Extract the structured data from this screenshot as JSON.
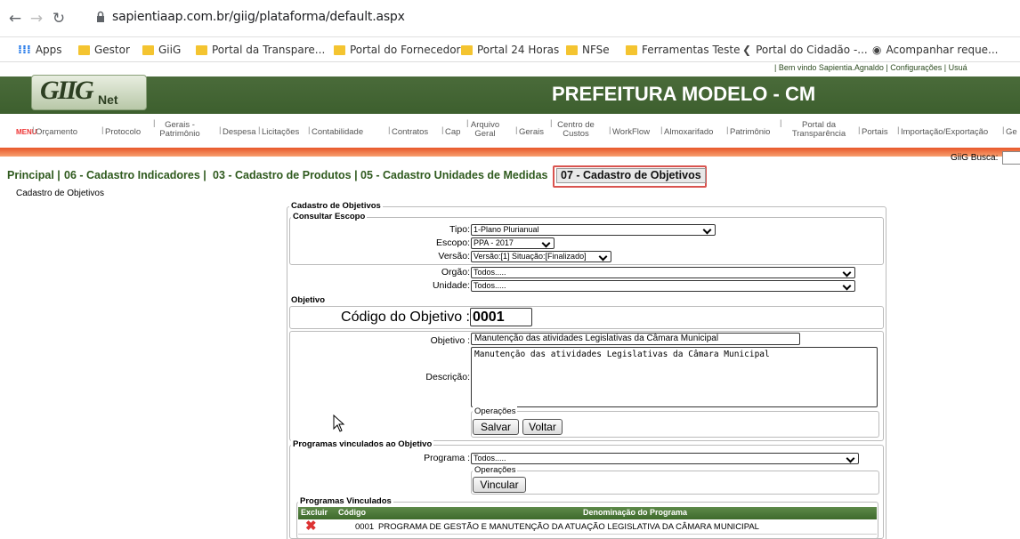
{
  "browser": {
    "url": "sapientiaap.com.br/giig/plataforma/default.aspx",
    "bookmarks": [
      "Apps",
      "Gestor",
      "GiiG",
      "Portal da Transpare...",
      "Portal do Fornecedor",
      "Portal 24 Horas",
      "NFSe",
      "Ferramentas Teste",
      "Portal do Cidadão -...",
      "Acompanhar reque..."
    ]
  },
  "header": {
    "welcome": "| Bem vindo Sapientia.Agnaldo   |  Configurações   |  Usuá",
    "logo_text": "GIIG",
    "logo_sub": "Net",
    "title": "PREFEITURA MODELO - CM"
  },
  "menu": {
    "label": "MENU",
    "items": [
      "Orçamento",
      "Protocolo",
      "Gerais - Patrimônio",
      "Despesa",
      "Licitações",
      "Contabilidade",
      "Contratos",
      "Cap",
      "Arquivo Geral",
      "Gerais",
      "Centro de Custos",
      "WorkFlow",
      "Almoxarifado",
      "Patrimônio",
      "Portal da Transparência",
      "Portais",
      "Importação/Exportação",
      "Ge"
    ],
    "busca_label": "GiiG Busca:"
  },
  "tabs": [
    "Principal",
    "06 - Cadastro Indicadores",
    "03 - Cadastro de Produtos",
    "05 - Cadastro Unidades de Medidas",
    "07 - Cadastro de Objetivos"
  ],
  "breadcrumb": "Cadastro de Objetivos",
  "form": {
    "legend_main": "Cadastro de Objetivos",
    "escopo": {
      "legend": "Consultar Escopo",
      "tipo_label": "Tipo:",
      "tipo_value": "1-Plano Plurianual",
      "escopo_label": "Escopo:",
      "escopo_value": "PPA - 2017",
      "versao_label": "Versão:",
      "versao_value": "Versão:[1] Situação:[Finalizado]",
      "orgao_label": "Orgão:",
      "orgao_value": "Todos.....",
      "unidade_label": "Unidade:",
      "unidade_value": "Todos....."
    },
    "objetivo": {
      "legend": "Objetivo",
      "codigo_label": "Código do Objetivo :",
      "codigo_value": "0001",
      "objetivo_label": "Objetivo :",
      "objetivo_value": "Manutenção das atividades Legislativas da Câmara Municipal",
      "descricao_label": "Descrição:",
      "descricao_value": "Manutenção das atividades Legislativas da Câmara Municipal",
      "operacoes_legend": "Operações",
      "salvar": "Salvar",
      "voltar": "Voltar"
    },
    "programas": {
      "legend": "Programas vinculados ao Objetivo",
      "programa_label": "Programa :",
      "programa_value": "Todos.....",
      "operacoes_legend": "Operações",
      "vincular": "Vincular",
      "vinculados_legend": "Programas Vinculados",
      "columns": [
        "Excluir",
        "Código",
        "Denominação do Programa"
      ],
      "rows": [
        {
          "codigo": "0001",
          "denominacao": "PROGRAMA DE GESTÃO E MANUTENÇÃO DA ATUAÇÃO LEGISLATIVA DA CÂMARA MUNICIPAL"
        }
      ]
    }
  },
  "colors": {
    "header_green": "#3d5f2e",
    "menu_orange": "#e8572a",
    "tab_green": "#2f5a1e",
    "highlight": "#d9534f"
  }
}
